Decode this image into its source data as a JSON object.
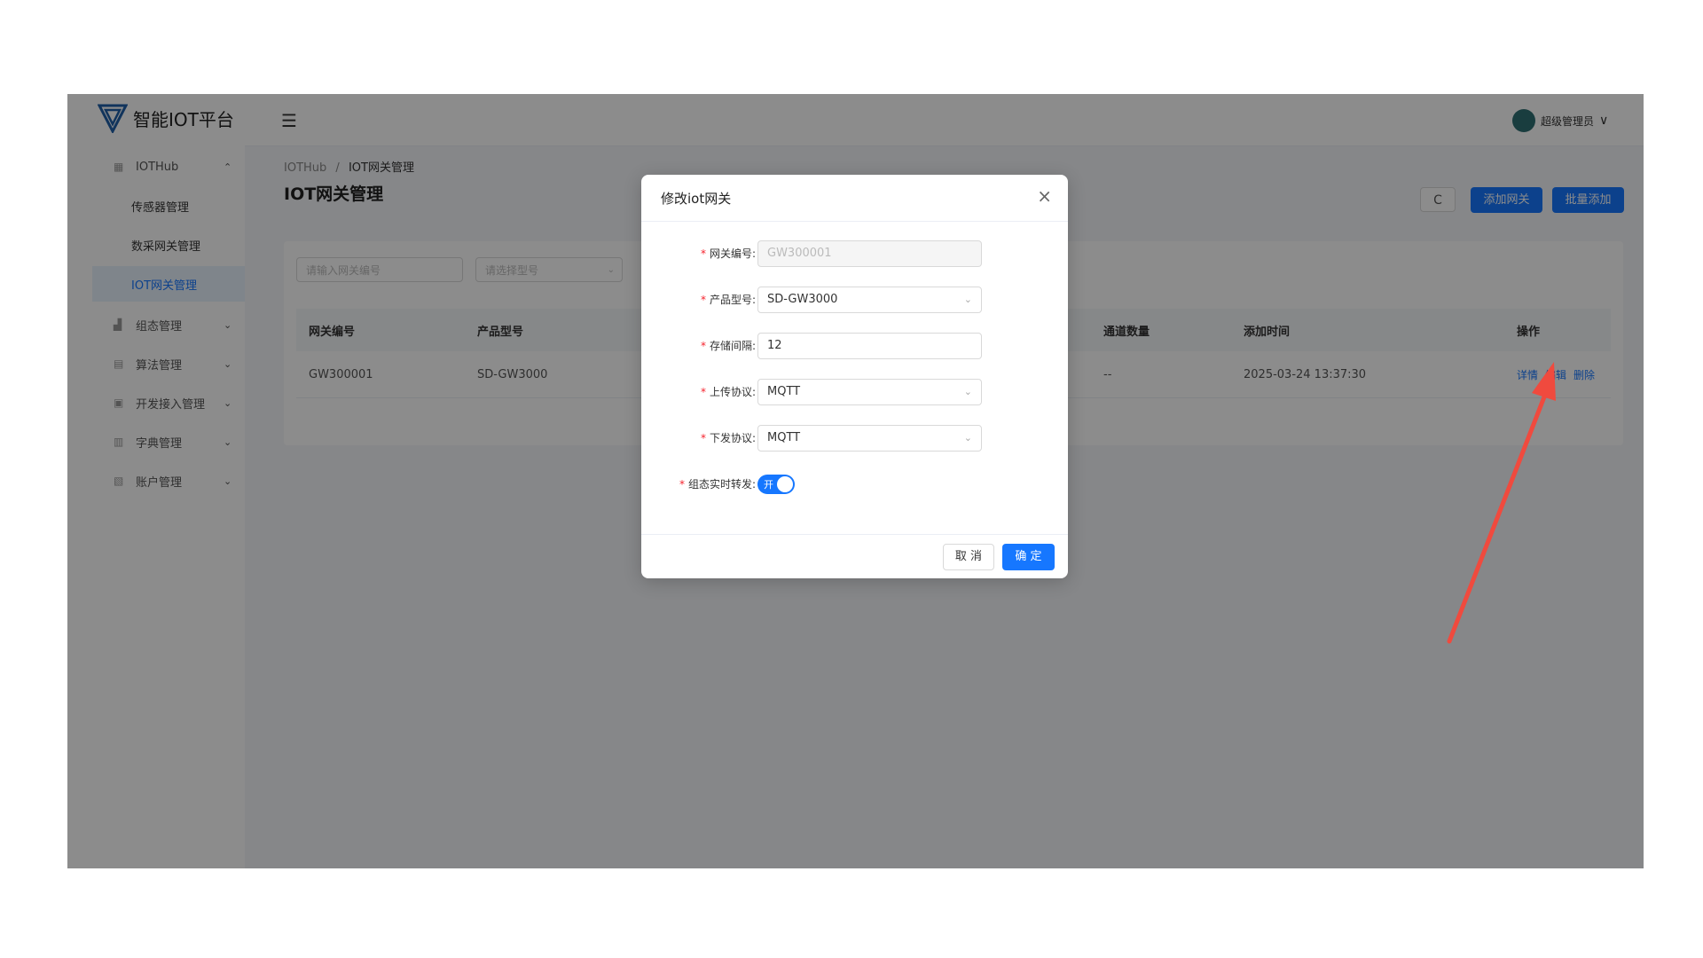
{
  "header": {
    "brand": "智能IOT平台",
    "menu_toggle_icon": "menu-fold-icon",
    "user_name": "超级管理员",
    "user_chevron": "∨"
  },
  "sidebar": {
    "groups": [
      {
        "label": "IOTHub",
        "icon": "appstore-icon",
        "expanded": true,
        "chevron": "⌃"
      },
      {
        "label": "组态管理",
        "icon": "layout-icon",
        "expanded": false,
        "chevron": "⌄"
      },
      {
        "label": "算法管理",
        "icon": "calculator-icon",
        "expanded": false,
        "chevron": "⌄"
      },
      {
        "label": "开发接入管理",
        "icon": "api-icon",
        "expanded": false,
        "chevron": "⌄"
      },
      {
        "label": "字典管理",
        "icon": "book-icon",
        "expanded": false,
        "chevron": "⌄"
      },
      {
        "label": "账户管理",
        "icon": "user-card-icon",
        "expanded": false,
        "chevron": "⌄"
      }
    ],
    "items": [
      {
        "label": "传感器管理"
      },
      {
        "label": "数采网关管理"
      },
      {
        "label": "IOT网关管理",
        "active": true
      }
    ]
  },
  "breadcrumb": {
    "root": "IOTHub",
    "sep": "/",
    "current": "IOT网关管理"
  },
  "page_title": "IOT网关管理",
  "toolbar": {
    "refresh": "C",
    "add": "添加网关",
    "batch_add": "批量添加"
  },
  "search": {
    "gateway_placeholder": "请输入网关编号",
    "model_placeholder": "请选择型号"
  },
  "table": {
    "columns": [
      "网关编号",
      "产品型号",
      "通道数量",
      "添加时间",
      "操作"
    ],
    "rows": [
      {
        "gateway_no": "GW300001",
        "model": "SD-GW3000",
        "channels": "--",
        "added": "2025-03-24 13:37:30"
      }
    ],
    "actions": [
      "详情",
      "编辑",
      "删除"
    ]
  },
  "modal": {
    "title": "修改iot网关",
    "close": "×",
    "fields": {
      "gateway_no": {
        "label": "网关编号:",
        "value": "GW300001"
      },
      "model": {
        "label": "产品型号:",
        "value": "SD-GW3000"
      },
      "interval": {
        "label": "存储间隔:",
        "value": "12"
      },
      "upload": {
        "label": "上传协议:",
        "value": "MQTT"
      },
      "download": {
        "label": "下发协议:",
        "value": "MQTT"
      },
      "realtime": {
        "label": "组态实时转发:",
        "switch_text": "开",
        "on": true
      }
    },
    "required_mark": "*",
    "cancel": "取 消",
    "ok": "确 定"
  },
  "colors": {
    "primary": "#1677ff",
    "annotation_arrow": "#f04a3e",
    "overlay": "rgba(0,0,0,0.45)"
  }
}
